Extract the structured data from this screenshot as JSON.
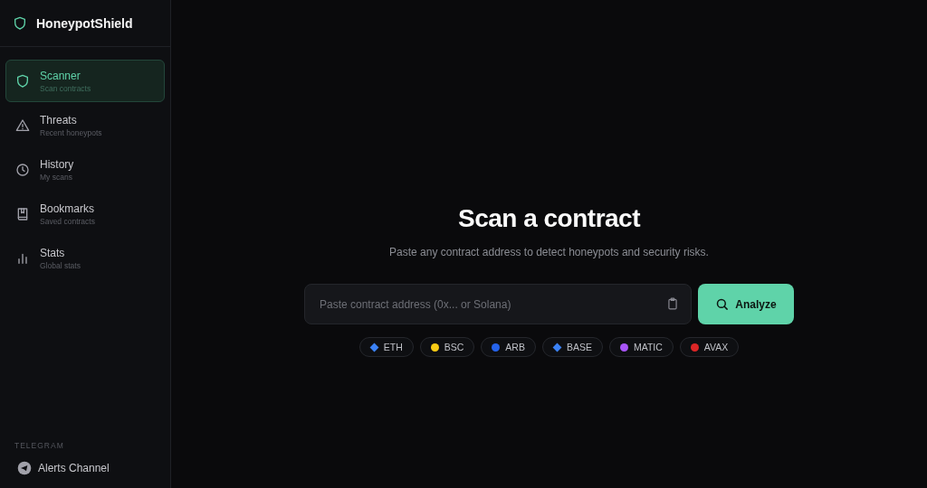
{
  "brand": {
    "name": "HoneypotShield"
  },
  "nav": [
    {
      "kind": "shield",
      "label": "Scanner",
      "sub": "Scan contracts",
      "selected": true
    },
    {
      "kind": "warning",
      "label": "Threats",
      "sub": "Recent honeypots",
      "selected": false
    },
    {
      "kind": "clock",
      "label": "History",
      "sub": "My scans",
      "selected": false
    },
    {
      "kind": "book",
      "label": "Bookmarks",
      "sub": "Saved contracts",
      "selected": false
    },
    {
      "kind": "chart",
      "label": "Stats",
      "sub": "Global stats",
      "selected": false
    }
  ],
  "telegram": {
    "heading": "TELEGRAM",
    "items": [
      {
        "label": "Alerts Channel"
      }
    ]
  },
  "main": {
    "title": "Scan a contract",
    "subtitle": "Paste any contract address to detect honeypots and security risks.",
    "placeholder": "Paste contract address (0x... or Solana)",
    "button": "Analyze",
    "chains": [
      {
        "label": "ETH",
        "kind": "diamond",
        "color": "#3b82f6"
      },
      {
        "label": "BSC",
        "kind": "circle",
        "color": "#facc15"
      },
      {
        "label": "ARB",
        "kind": "circle",
        "color": "#2563eb"
      },
      {
        "label": "BASE",
        "kind": "diamond",
        "color": "#3b82f6"
      },
      {
        "label": "MATIC",
        "kind": "circle",
        "color": "#a855f7"
      },
      {
        "label": "AVAX",
        "kind": "circle",
        "color": "#dc2626"
      }
    ]
  }
}
